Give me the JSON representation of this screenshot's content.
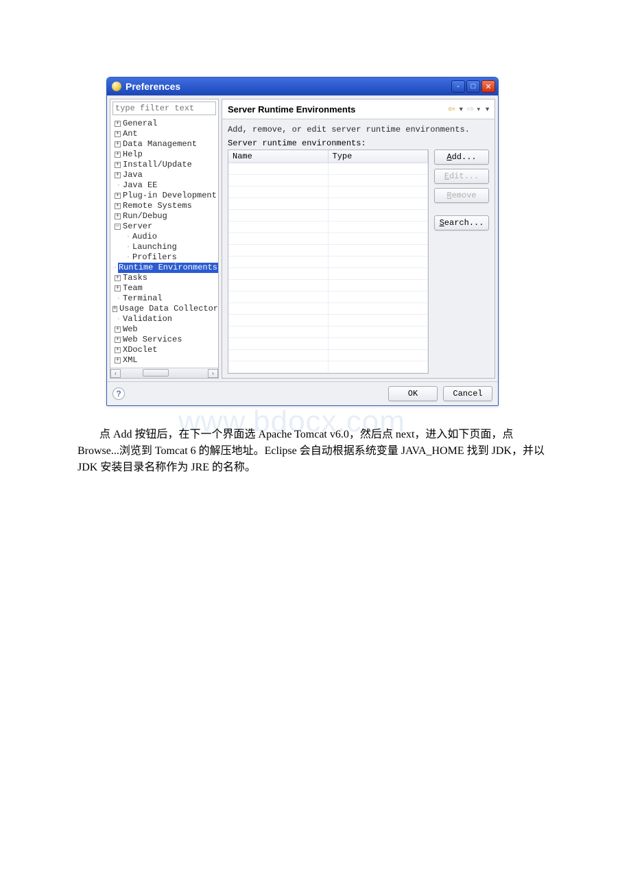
{
  "window": {
    "title": "Preferences"
  },
  "filter_placeholder": "type filter text",
  "tree": {
    "items": [
      {
        "label": "General",
        "depth": 0,
        "expand": "plus"
      },
      {
        "label": "Ant",
        "depth": 0,
        "expand": "plus"
      },
      {
        "label": "Data Management",
        "depth": 0,
        "expand": "plus"
      },
      {
        "label": "Help",
        "depth": 0,
        "expand": "plus"
      },
      {
        "label": "Install/Update",
        "depth": 0,
        "expand": "plus"
      },
      {
        "label": "Java",
        "depth": 0,
        "expand": "plus"
      },
      {
        "label": "Java EE",
        "depth": 0,
        "expand": "none"
      },
      {
        "label": "Plug-in Development",
        "depth": 0,
        "expand": "plus"
      },
      {
        "label": "Remote Systems",
        "depth": 0,
        "expand": "plus"
      },
      {
        "label": "Run/Debug",
        "depth": 0,
        "expand": "plus"
      },
      {
        "label": "Server",
        "depth": 0,
        "expand": "minus"
      },
      {
        "label": "Audio",
        "depth": 1,
        "expand": "none"
      },
      {
        "label": "Launching",
        "depth": 1,
        "expand": "none"
      },
      {
        "label": "Profilers",
        "depth": 1,
        "expand": "none"
      },
      {
        "label": "Runtime Environments",
        "depth": 1,
        "expand": "none",
        "selected": true
      },
      {
        "label": "Tasks",
        "depth": 0,
        "expand": "plus"
      },
      {
        "label": "Team",
        "depth": 0,
        "expand": "plus"
      },
      {
        "label": "Terminal",
        "depth": 0,
        "expand": "none"
      },
      {
        "label": "Usage Data Collector",
        "depth": 0,
        "expand": "plus"
      },
      {
        "label": "Validation",
        "depth": 0,
        "expand": "none"
      },
      {
        "label": "Web",
        "depth": 0,
        "expand": "plus"
      },
      {
        "label": "Web Services",
        "depth": 0,
        "expand": "plus"
      },
      {
        "label": "XDoclet",
        "depth": 0,
        "expand": "plus"
      },
      {
        "label": "XML",
        "depth": 0,
        "expand": "plus"
      }
    ]
  },
  "page": {
    "title": "Server Runtime Environments",
    "description": "Add, remove, or edit server runtime environments.",
    "list_label": "Server runtime environments:",
    "columns": {
      "name": "Name",
      "type": "Type"
    },
    "buttons": {
      "add": "Add...",
      "edit": "Edit...",
      "remove": "Remove",
      "search": "Search..."
    }
  },
  "footer": {
    "ok": "OK",
    "cancel": "Cancel"
  },
  "watermark": "www.bdocx.com",
  "caption": "　　点 Add 按钮后，在下一个界面选 Apache Tomcat v6.0，然后点 next，进入如下页面，点 Browse...浏览到 Tomcat 6 的解压地址。Eclipse 会自动根据系统变量 JAVA_HOME 找到 JDK，并以 JDK 安装目录名称作为 JRE 的名称。"
}
